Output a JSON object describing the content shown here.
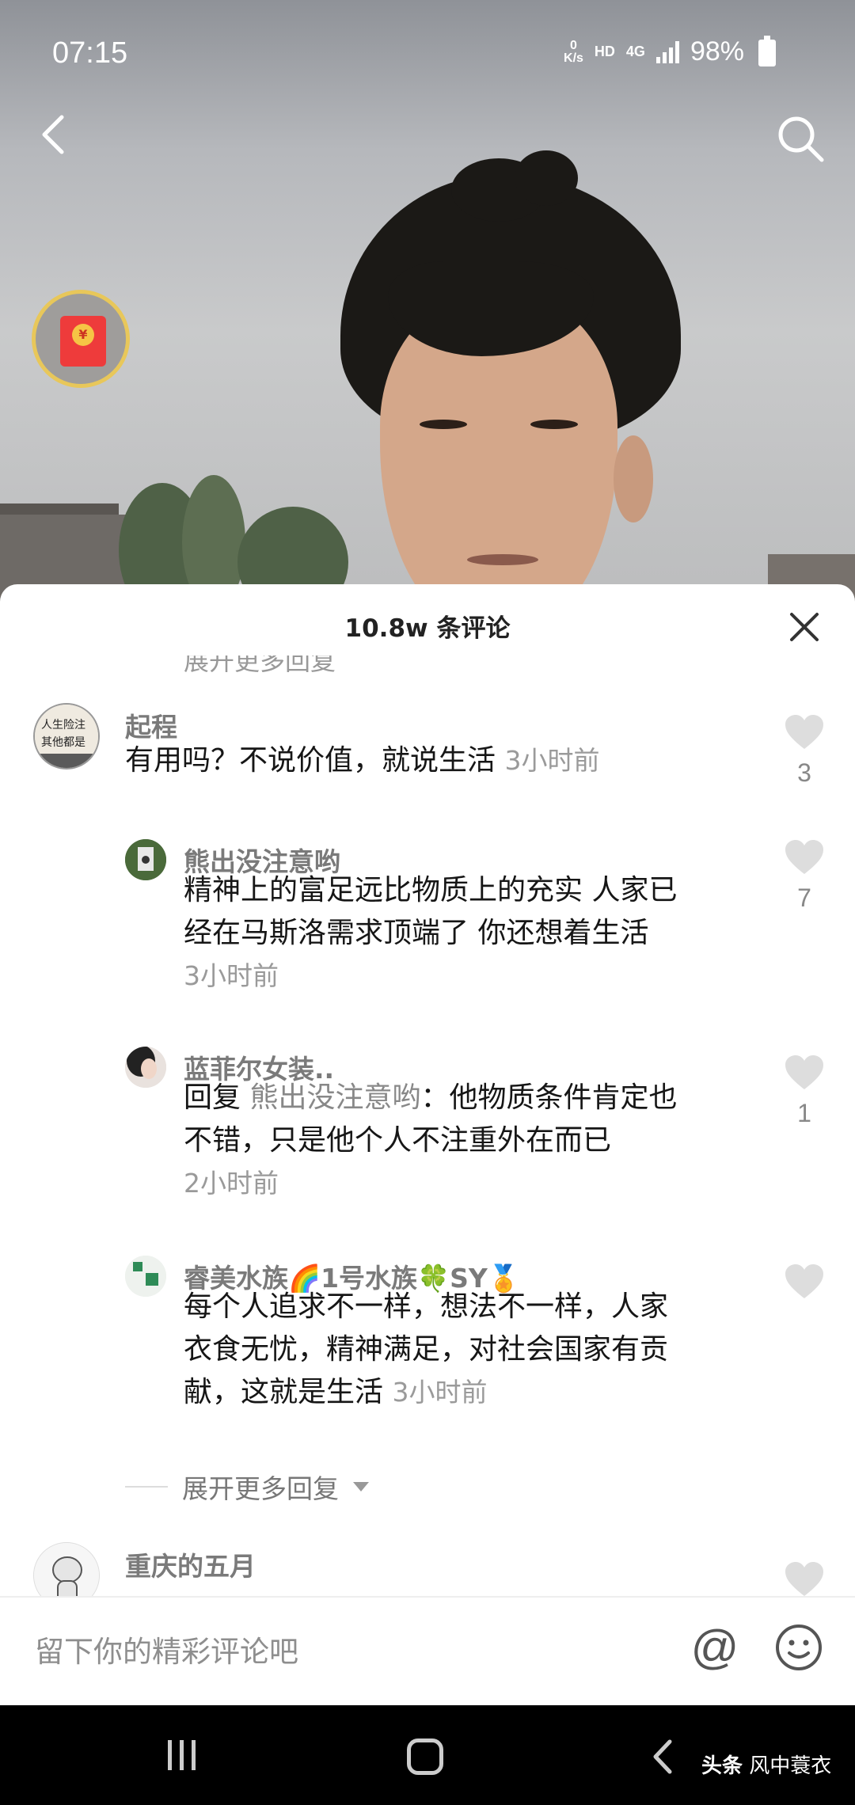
{
  "status_bar": {
    "time": "07:15",
    "net_speed_value": "0",
    "net_speed_unit": "K/s",
    "hd": "HD",
    "network": "4G",
    "battery": "98%"
  },
  "comments_panel": {
    "title": "10.8w 条评论",
    "cut_expand": "展开更多回复",
    "comments": [
      {
        "username": "起程",
        "text": "有用吗？不说价值，就说生活",
        "time": "3小时前",
        "likes": "3"
      },
      {
        "username": "熊出没注意哟",
        "text_line1": "精神上的富足远比物质上的充实 人家已",
        "text_line2": "经在马斯洛需求顶端了 你还想着生活",
        "time": "3小时前",
        "likes": "7"
      },
      {
        "username": "蓝菲尔女装..",
        "reply_prefix": "回复 ",
        "reply_to": "熊出没注意哟",
        "text_line1": "：他物质条件肯定也",
        "text_line2": "不错，只是他个人不注重外在而已",
        "time": "2小时前",
        "likes": "1"
      },
      {
        "username_part1": "睿美水族",
        "username_emoji1": "🌈",
        "username_part2": "1号水族",
        "username_emoji2": "🍀",
        "username_part3": "SY",
        "username_emoji3": "🏅",
        "text_line1": "每个人追求不一样，想法不一样，人家",
        "text_line2": "衣食无忧，精神满足，对社会国家有贡",
        "text_line3": "献，这就是生活",
        "time": "3小时前",
        "likes": ""
      },
      {
        "username": "重庆的五月",
        "likes": ""
      }
    ],
    "expand_more": "展开更多回复"
  },
  "input_bar": {
    "placeholder": "留下你的精彩评论吧",
    "at_symbol": "@"
  },
  "watermark": {
    "brand": "头条",
    "author": "风中蓑衣"
  },
  "colors": {
    "panel_bg": "#ffffff",
    "heart": "#dddddd",
    "username": "#7a7a7a",
    "time": "#9a9a9a"
  }
}
